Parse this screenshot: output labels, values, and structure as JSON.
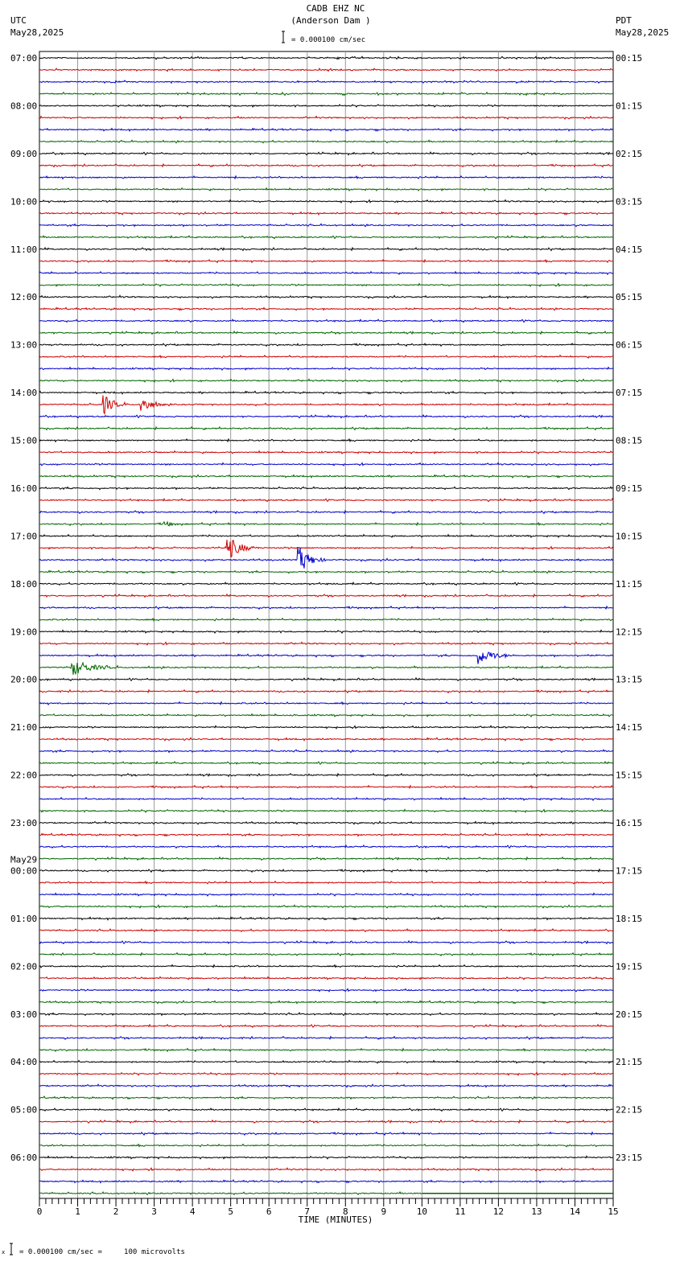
{
  "header": {
    "title": "CADB EHZ NC",
    "subtitle": "(Anderson Dam )",
    "scale": "= 0.000100 cm/sec",
    "left_tz": "UTC",
    "left_date": "May28,2025",
    "right_tz": "PDT",
    "right_date": "May28,2025"
  },
  "footer": {
    "scale_note": "= 0.000100 cm/sec =     100 microvolts"
  },
  "chart_data": {
    "type": "line",
    "subtype": "helicorder",
    "xlabel": "TIME (MINUTES)",
    "xlim": [
      0,
      15
    ],
    "x_ticks": [
      "0",
      "1",
      "2",
      "3",
      "4",
      "5",
      "6",
      "7",
      "8",
      "9",
      "10",
      "11",
      "12",
      "13",
      "14",
      "15"
    ],
    "minor_ticks_per_minute": 6,
    "trace_minutes": 15,
    "trace_count": 96,
    "trace_colors": [
      "#000000",
      "#cc0000",
      "#0000cc",
      "#006600"
    ],
    "left_labels": [
      "07:00",
      "08:00",
      "09:00",
      "10:00",
      "11:00",
      "12:00",
      "13:00",
      "14:00",
      "15:00",
      "16:00",
      "17:00",
      "18:00",
      "19:00",
      "20:00",
      "21:00",
      "22:00",
      "23:00",
      "00:00",
      "01:00",
      "02:00",
      "03:00",
      "04:00",
      "05:00",
      "06:00"
    ],
    "date_change_label": "May29",
    "date_change_index": 17,
    "right_labels": [
      "00:15",
      "01:15",
      "02:15",
      "03:15",
      "04:15",
      "05:15",
      "06:15",
      "07:15",
      "08:15",
      "09:15",
      "10:15",
      "11:15",
      "12:15",
      "13:15",
      "14:15",
      "15:15",
      "16:15",
      "17:15",
      "18:15",
      "19:15",
      "20:15",
      "21:15",
      "22:15",
      "23:15"
    ],
    "events": [
      {
        "trace": 29,
        "minute": 1.7,
        "amplitude": 12,
        "duration": 0.6
      },
      {
        "trace": 29,
        "minute": 2.7,
        "amplitude": 10,
        "duration": 0.6
      },
      {
        "trace": 39,
        "minute": 3.3,
        "amplitude": 3,
        "duration": 0.4
      },
      {
        "trace": 41,
        "minute": 4.95,
        "amplitude": 14,
        "duration": 0.8
      },
      {
        "trace": 42,
        "minute": 6.8,
        "amplitude": 16,
        "duration": 0.7
      },
      {
        "trace": 50,
        "minute": 11.5,
        "amplitude": 10,
        "duration": 0.9
      },
      {
        "trace": 51,
        "minute": 0.85,
        "amplitude": 10,
        "duration": 1.2
      }
    ],
    "data_end": {
      "trace": 95,
      "minute": 10
    }
  }
}
